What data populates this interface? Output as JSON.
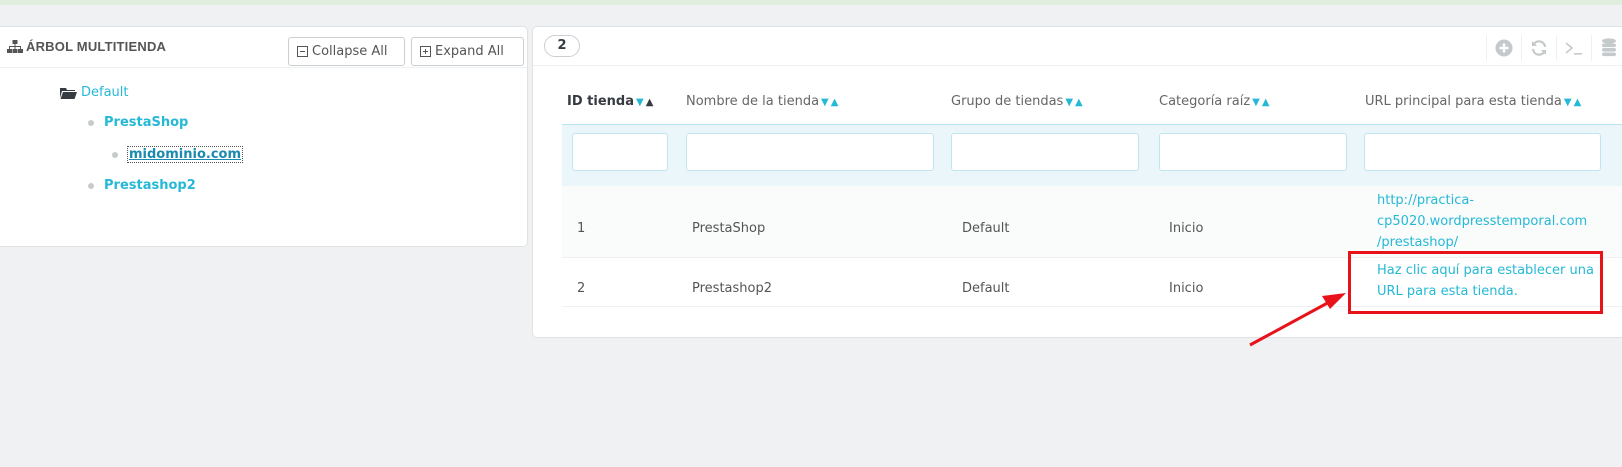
{
  "tree": {
    "title": "ÁRBOL MULTITIENDA",
    "collapse_label": "Collapse All",
    "expand_label": "Expand All",
    "nodes": {
      "root": "Default",
      "shop1": "PrestaShop",
      "shop1_child": "midominio.com",
      "shop2": "Prestashop2"
    }
  },
  "table": {
    "count": "2",
    "columns": {
      "id": "ID tienda",
      "name": "Nombre de la tienda",
      "group": "Grupo de tiendas",
      "category": "Categoría raíz",
      "url": "URL principal para esta tienda"
    },
    "rows": [
      {
        "id": "1",
        "name": "PrestaShop",
        "group": "Default",
        "category": "Inicio",
        "url_line1": "http://practica-",
        "url_line2": "cp5020.wordpresstemporal.com",
        "url_line3": "/prestashop/"
      },
      {
        "id": "2",
        "name": "Prestashop2",
        "group": "Default",
        "category": "Inicio",
        "url_line1": "Haz clic aquí para establecer una",
        "url_line2": "URL para esta tienda."
      }
    ]
  },
  "colors": {
    "accent": "#25b9d7",
    "highlight": "#e8121a"
  },
  "icons": {
    "tree": "sitemap-icon",
    "folder": "folder-open-icon",
    "add": "plus-circle-icon",
    "refresh": "refresh-icon",
    "sql": "terminal-icon",
    "export": "database-icon"
  }
}
